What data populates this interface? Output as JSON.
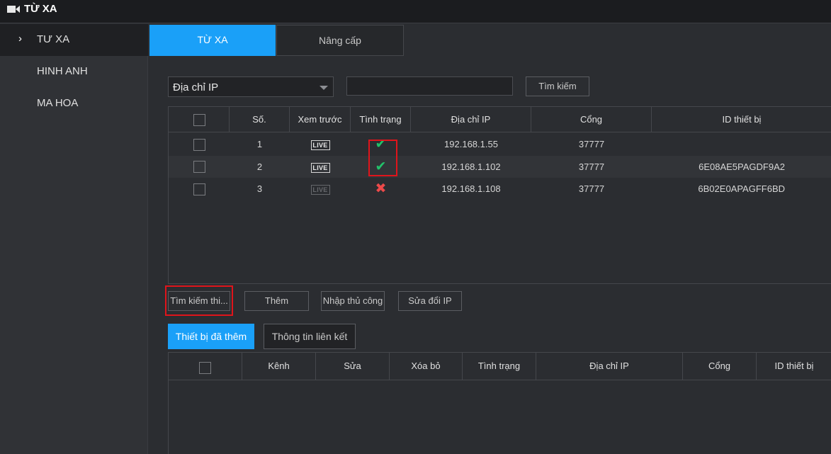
{
  "window": {
    "title": "TỪ XA",
    "title_icon": "video-camera-icon"
  },
  "sidebar": {
    "items": [
      {
        "label": "TƯ XA",
        "active": true,
        "chevron": "›"
      },
      {
        "label": "HINH ANH",
        "active": false
      },
      {
        "label": "MA HOA",
        "active": false
      }
    ]
  },
  "tabs": [
    {
      "label": "TỪ XA",
      "active": true
    },
    {
      "label": "Nâng cấp",
      "active": false
    }
  ],
  "search": {
    "filter_value": "Địa chỉ IP",
    "input_value": "",
    "button_label": "Tìm kiếm"
  },
  "device_table": {
    "headers": [
      "Số.",
      "Xem trước",
      "Tình trạng",
      "Địa chỉ IP",
      "Cổng",
      "ID thiết bị"
    ],
    "live_label": "LIVE",
    "rows": [
      {
        "no": "1",
        "status": "online",
        "status_glyph": "✔",
        "ip": "192.168.1.55",
        "port": "37777",
        "device_id": ""
      },
      {
        "no": "2",
        "status": "online",
        "status_glyph": "✔",
        "ip": "192.168.1.102",
        "port": "37777",
        "device_id": "6E08AE5PAGDF9A2"
      },
      {
        "no": "3",
        "status": "offline",
        "status_glyph": "✖",
        "ip": "192.168.1.108",
        "port": "37777",
        "device_id": "6B02E0APAGFF6BD"
      }
    ]
  },
  "actions": {
    "search_device": "Tìm kiếm thi...",
    "add": "Thêm",
    "manual_add": "Nhập thủ công",
    "modify_ip": "Sửa đổi IP"
  },
  "subtabs": [
    {
      "label": "Thiết bị đã thêm",
      "active": true
    },
    {
      "label": "Thông tin liên kết",
      "active": false
    }
  ],
  "added_table": {
    "headers": [
      "Kênh",
      "Sửa",
      "Xóa bỏ",
      "Tình trạng",
      "Địa chỉ IP",
      "Cổng",
      "ID thiết bị"
    ]
  },
  "colors": {
    "accent": "#1aa0f8",
    "ok": "#22c26a",
    "bad": "#ee4a4a",
    "highlight": "#e0141b"
  }
}
